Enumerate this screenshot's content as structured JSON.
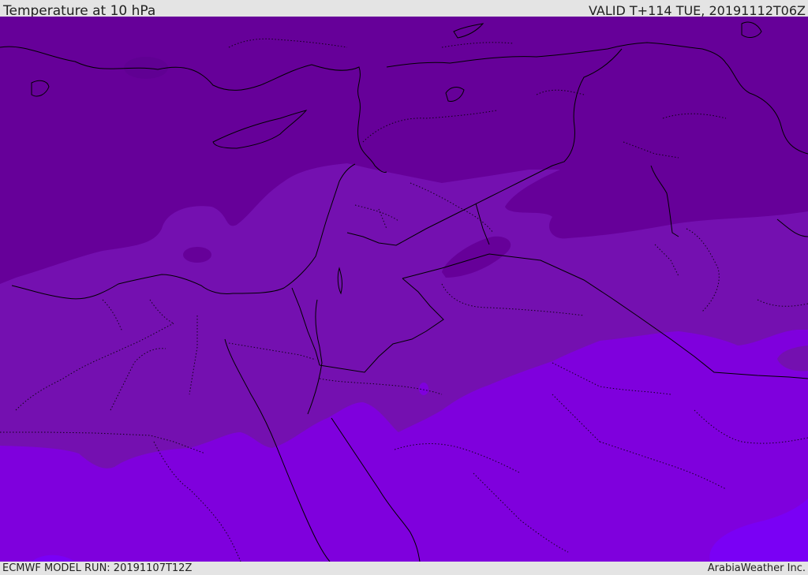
{
  "header": {
    "title": "Temperature at 10 hPa",
    "valid": "VALID T+114 TUE, 20191112T06Z"
  },
  "footer": {
    "model_run": "ECMWF MODEL RUN: 20191107T12Z",
    "credit": "ArabiaWeather Inc."
  },
  "colors": {
    "band_darkest": "#660099",
    "band_mid": "#7410b0",
    "band_bright": "#7f00dd",
    "band_brightest": "#7a00f5",
    "border": "#000000"
  }
}
